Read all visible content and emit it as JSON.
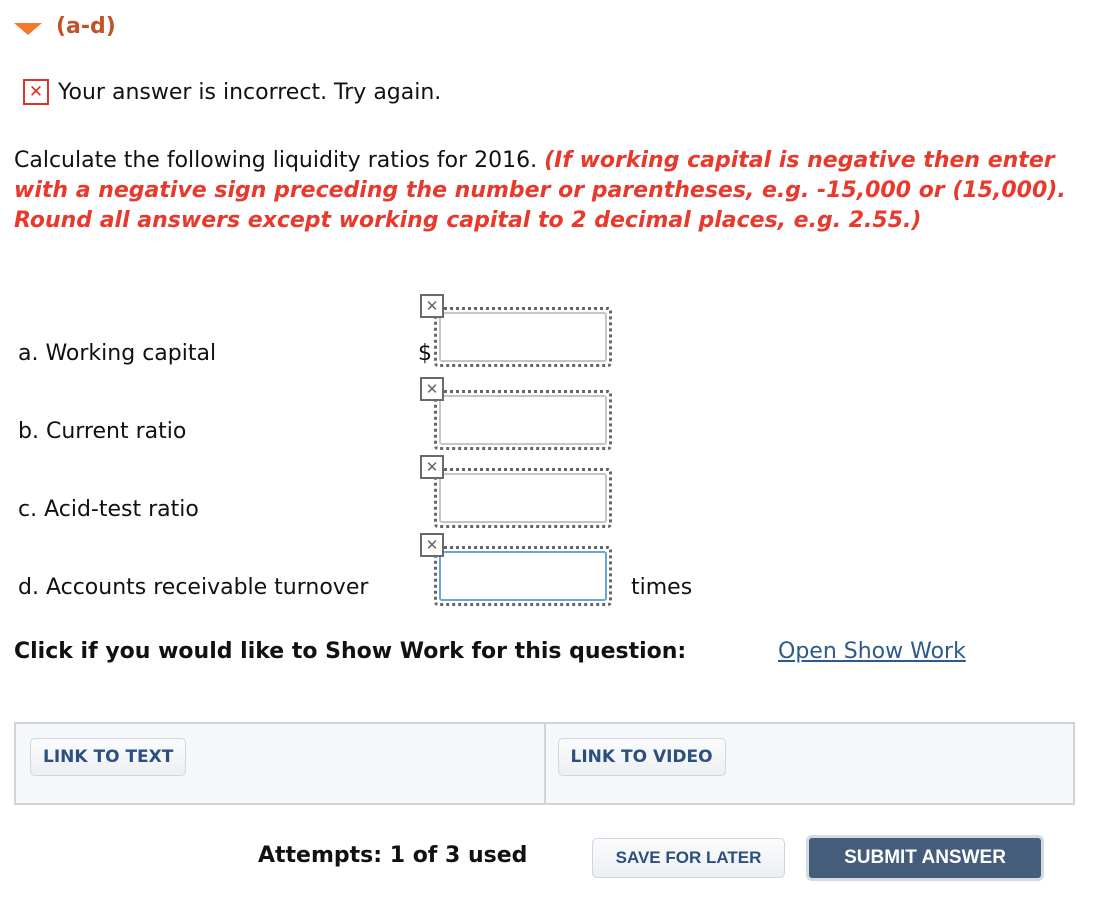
{
  "section": {
    "title": "(a-d)",
    "toggle_icon": "triangle-down-icon"
  },
  "feedback": {
    "icon": "x-mark-icon",
    "text": "Your answer is incorrect.  Try again."
  },
  "instructions": {
    "text": "Calculate the following liquidity ratios for 2016. ",
    "hint": "(If working capital is negative then enter with a negative sign preceding the number or parentheses, e.g. -15,000 or (15,000). Round all answers except working capital to 2 decimal places, e.g. 2.55.)"
  },
  "questions": [
    {
      "label": "a. Working capital",
      "prefix": "$",
      "suffix": "",
      "value": "",
      "status_icon": "x-mark-icon"
    },
    {
      "label": "b. Current ratio",
      "prefix": "",
      "suffix": "",
      "value": "",
      "status_icon": "x-mark-icon"
    },
    {
      "label": "c. Acid-test ratio",
      "prefix": "",
      "suffix": "",
      "value": "",
      "status_icon": "x-mark-icon"
    },
    {
      "label": "d. Accounts receivable turnover",
      "prefix": "",
      "suffix": "times",
      "value": "",
      "status_icon": "x-mark-icon"
    }
  ],
  "show_work": {
    "prompt": "Click if you would like to Show Work for this question:",
    "link": "Open Show Work"
  },
  "resources": {
    "link_text": "LINK TO TEXT",
    "link_video": "LINK TO VIDEO"
  },
  "footer": {
    "attempts": "Attempts: 1 of 3 used",
    "save": "SAVE FOR LATER",
    "submit": "SUBMIT ANSWER"
  },
  "colors": {
    "accent_orange": "#f07a28",
    "error_red": "#e8392c",
    "link_blue": "#2d5a8a",
    "submit_bg": "#445d7a"
  }
}
